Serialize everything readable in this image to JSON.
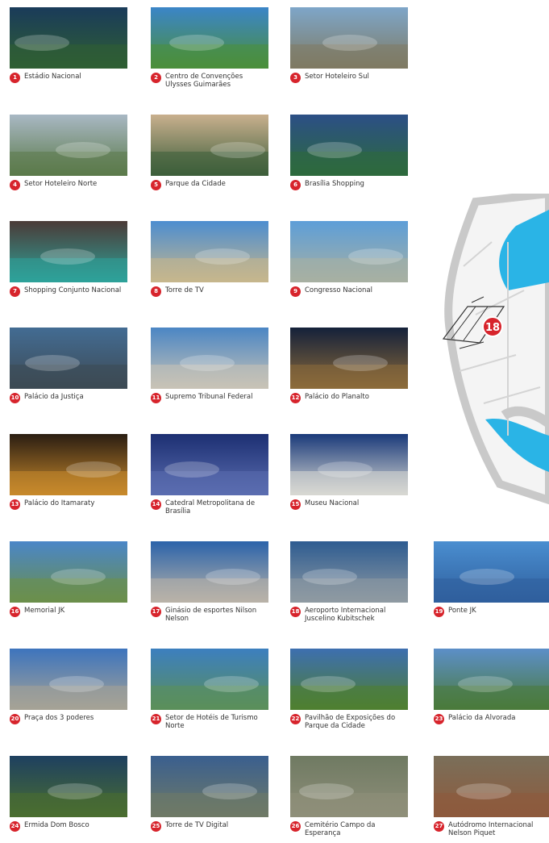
{
  "map_marker": "18",
  "items": [
    {
      "n": "1",
      "label": "Estádio Nacional",
      "c": [
        "#1a3b5a",
        "#2f5f33"
      ]
    },
    {
      "n": "2",
      "label": "Centro de Convenções Ulysses Guimarães",
      "c": [
        "#3b85c8",
        "#4b8f3a"
      ]
    },
    {
      "n": "3",
      "label": "Setor Hoteleiro Sul",
      "c": [
        "#7ea6c9",
        "#7f7a62"
      ]
    },
    {
      "n": "4",
      "label": "Setor Hoteleiro Norte",
      "c": [
        "#a9b8c4",
        "#5b7a4a"
      ]
    },
    {
      "n": "5",
      "label": "Parque da Cidade",
      "c": [
        "#c9b08e",
        "#3d5e3a"
      ]
    },
    {
      "n": "6",
      "label": "Brasília Shopping",
      "c": [
        "#2c4f86",
        "#2d6a3d"
      ]
    },
    {
      "n": "7",
      "label": "Shopping Conjunto Nacional",
      "c": [
        "#4b3a37",
        "#2ea39a"
      ]
    },
    {
      "n": "8",
      "label": "Torre de TV",
      "c": [
        "#4c8dd0",
        "#c7b78d"
      ]
    },
    {
      "n": "9",
      "label": "Congresso Nacional",
      "c": [
        "#5d9ed8",
        "#a8b0a2"
      ]
    },
    {
      "n": "10",
      "label": "Palácio da Justiça",
      "c": [
        "#436c93",
        "#3d4a54"
      ]
    },
    {
      "n": "11",
      "label": "Supremo Tribunal Federal",
      "c": [
        "#4b86c4",
        "#c8c3b6"
      ]
    },
    {
      "n": "12",
      "label": "Palácio do Planalto",
      "c": [
        "#14213a",
        "#8d6b3b"
      ]
    },
    {
      "n": "13",
      "label": "Palácio do Itamaraty",
      "c": [
        "#2a1d12",
        "#c98a2c"
      ]
    },
    {
      "n": "14",
      "label": "Catedral Metropolitana de Brasília",
      "c": [
        "#1c2f72",
        "#5b6db0"
      ]
    },
    {
      "n": "15",
      "label": "Museu Nacional",
      "c": [
        "#1a3a7a",
        "#d9d9d3"
      ]
    },
    {
      "n": "16",
      "label": "Memorial JK",
      "c": [
        "#4a86c8",
        "#6b8f4a"
      ]
    },
    {
      "n": "17",
      "label": "Ginásio de esportes Nilson Nelson",
      "c": [
        "#2b63aa",
        "#b9b3a8"
      ]
    },
    {
      "n": "18",
      "label": "Aeroporto Internacional Juscelino Kubitschek",
      "c": [
        "#2e5c91",
        "#8f9aa2"
      ]
    },
    {
      "n": "19",
      "label": "Ponte JK",
      "c": [
        "#4a8ed0",
        "#2f5f9d"
      ]
    },
    {
      "n": "20",
      "label": "Praça dos 3 poderes",
      "c": [
        "#3d74bd",
        "#a6a396"
      ]
    },
    {
      "n": "21",
      "label": "Setor de Hotéis de Turismo Norte",
      "c": [
        "#3c7fbf",
        "#5b8f5a"
      ]
    },
    {
      "n": "22",
      "label": "Pavilhão de Exposições do Parque da Cidade",
      "c": [
        "#3d6fb0",
        "#4f7f2f"
      ]
    },
    {
      "n": "23",
      "label": "Palácio da Alvorada",
      "c": [
        "#5c8fc8",
        "#4a7a3a"
      ]
    },
    {
      "n": "24",
      "label": "Ermida Dom Bosco",
      "c": [
        "#1e4060",
        "#4a6e30"
      ]
    },
    {
      "n": "25",
      "label": "Torre de TV Digital",
      "c": [
        "#3a5f8f",
        "#6f7a66"
      ]
    },
    {
      "n": "26",
      "label": "Cemitério Campo da Esperança",
      "c": [
        "#6f7a62",
        "#8f8f7a"
      ]
    },
    {
      "n": "27",
      "label": "Autódromo Internacional Nelson Piquet",
      "c": [
        "#7a6f5a",
        "#8e5a3c"
      ]
    }
  ]
}
